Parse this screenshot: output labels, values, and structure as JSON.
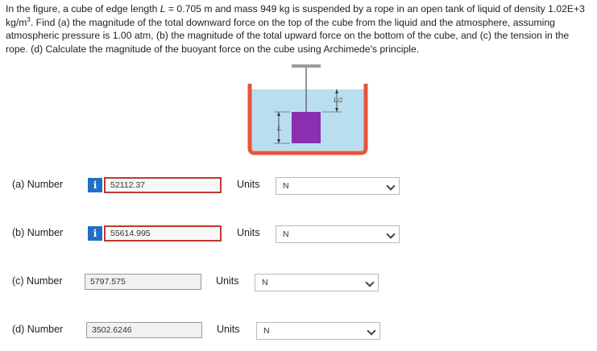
{
  "problem": {
    "text_pre": "In the figure, a cube of edge length ",
    "L_symbol": "L",
    "text_mid1": " = 0.705 m and mass 949 kg is suspended by a rope in an open tank of liquid of density 1.02E+3 kg/m",
    "exp": "3",
    "text_post": ". Find (a) the magnitude of the total downward force on the top of the cube from the liquid and the atmosphere, assuming atmospheric pressure is 1.00 atm, (b) the magnitude of the total upward force on the bottom of the cube, and (c) the tension in the rope. (d) Calculate the magnitude of the buoyant force on the cube using Archimede's principle."
  },
  "figure": {
    "label_L": "L",
    "label_half": "L/2",
    "colors": {
      "tank": "#e8533a",
      "liquid": "#b9def0",
      "cube": "#8a2fb0",
      "ceiling": "#9a9a9a"
    }
  },
  "rows": [
    {
      "label": "(a)  Number",
      "value": "52112.37",
      "has_info": true,
      "error": true,
      "units_label": "Units",
      "unit": "N"
    },
    {
      "label": "(b)  Number",
      "value": "55614.995",
      "has_info": true,
      "error": true,
      "units_label": "Units",
      "unit": "N"
    },
    {
      "label": "(c)  Number",
      "value": "5797.575",
      "has_info": false,
      "error": false,
      "units_label": "Units",
      "unit": "N"
    },
    {
      "label": "(d)  Number",
      "value": "3502.6246",
      "has_info": false,
      "error": false,
      "units_label": "Units",
      "unit": "N"
    }
  ],
  "icons": {
    "info": "i"
  }
}
